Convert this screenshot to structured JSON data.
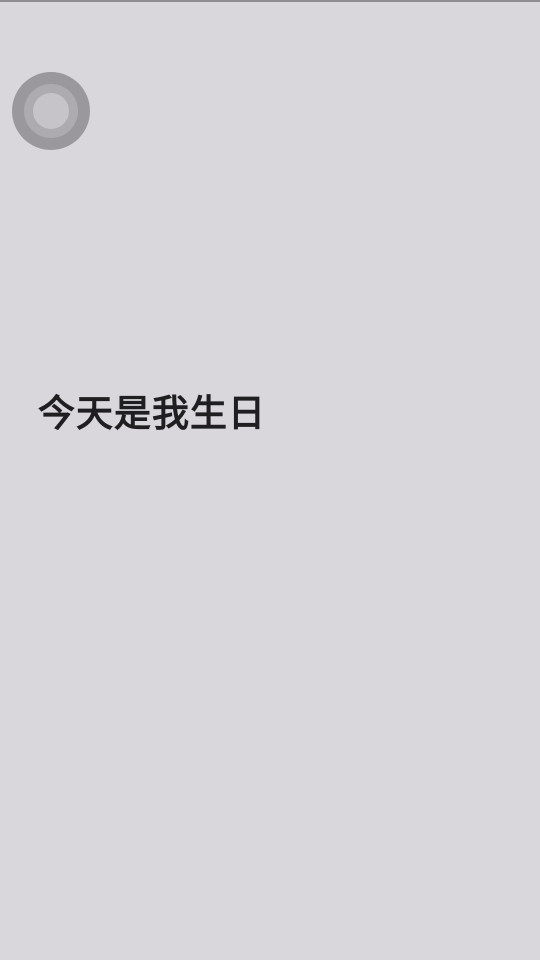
{
  "screen": {
    "background_color": "#d9d7db",
    "text_color": "#1f1e21"
  },
  "assistive_touch": {
    "icon": "assistive-touch-icon",
    "outer_color": "#9a989c",
    "inner_color": "#c6c4c8"
  },
  "message": {
    "text": "今天是我生日"
  }
}
